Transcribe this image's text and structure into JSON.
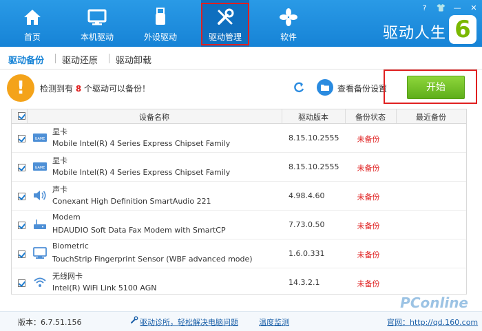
{
  "nav": {
    "items": [
      {
        "label": "首页",
        "icon": "home-icon"
      },
      {
        "label": "本机驱动",
        "icon": "monitor-icon"
      },
      {
        "label": "外设驱动",
        "icon": "usb-icon"
      },
      {
        "label": "驱动管理",
        "icon": "tools-icon"
      },
      {
        "label": "软件",
        "icon": "apps-icon"
      }
    ],
    "active": "驱动管理"
  },
  "window": {
    "buttons": [
      "?",
      "👕",
      "—",
      "✕"
    ]
  },
  "brand": {
    "name": "驱动人生",
    "logo_digit": "6"
  },
  "subtabs": {
    "backup": "驱动备份",
    "restore": "驱动还原",
    "uninstall": "驱动卸载"
  },
  "notice": {
    "prefix": "检测到有",
    "count": "8",
    "suffix": "个驱动可以备份！"
  },
  "actions": {
    "view_settings": "查看备份设置",
    "start": "开始"
  },
  "table": {
    "headers": {
      "name": "设备名称",
      "version": "驱动版本",
      "status": "备份状态",
      "last": "最近备份"
    },
    "rows": [
      {
        "category": "显卡",
        "device": "Mobile Intel(R) 4 Series Express Chipset Family",
        "version": "8.15.10.2555",
        "status": "未备份",
        "icon": "graphics-card-icon"
      },
      {
        "category": "显卡",
        "device": "Mobile Intel(R) 4 Series Express Chipset Family",
        "version": "8.15.10.2555",
        "status": "未备份",
        "icon": "graphics-card-icon"
      },
      {
        "category": "声卡",
        "device": "Conexant High Definition SmartAudio 221",
        "version": "4.98.4.60",
        "status": "未备份",
        "icon": "speaker-icon"
      },
      {
        "category": "Modem",
        "device": "HDAUDIO Soft Data Fax Modem with SmartCP",
        "version": "7.73.0.50",
        "status": "未备份",
        "icon": "modem-icon"
      },
      {
        "category": "Biometric",
        "device": "TouchStrip Fingerprint Sensor (WBF advanced mode)",
        "version": "1.6.0.331",
        "status": "未备份",
        "icon": "biometric-icon"
      },
      {
        "category": "无线网卡",
        "device": "Intel(R) WiFi Link 5100 AGN",
        "version": "14.3.2.1",
        "status": "未备份",
        "icon": "wifi-icon"
      }
    ]
  },
  "footer": {
    "version": "版本：6.7.51.156",
    "diagnose": "驱动诊所，轻松解决电脑问题",
    "temperature": "温度监测",
    "website": "官网：http://qd.160.com"
  },
  "watermark": "PConline",
  "colors": {
    "topbar": "#1683d6",
    "active_tab": "#0f6fbf",
    "start_button": "#6cbf24",
    "status_red": "#e02020",
    "highlight_box": "#e02020"
  }
}
